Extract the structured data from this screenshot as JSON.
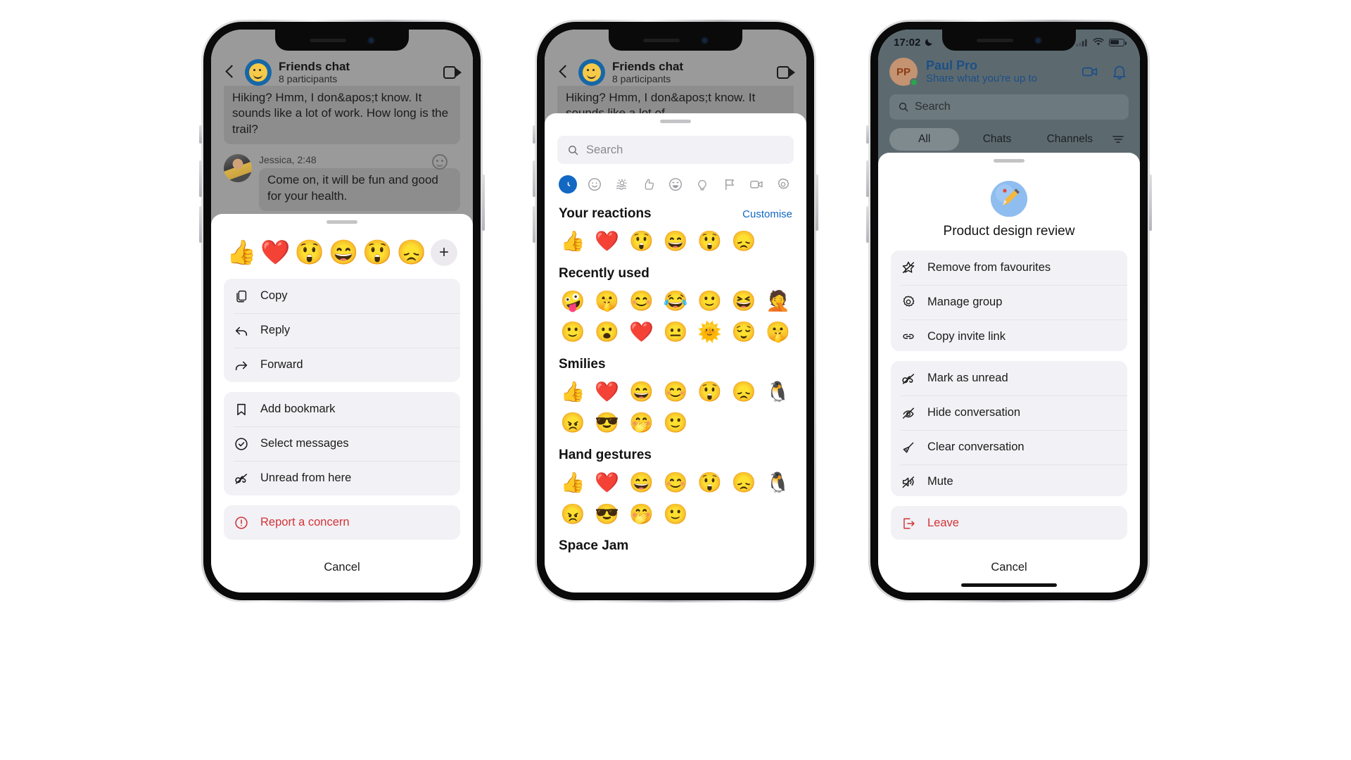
{
  "phone1": {
    "chat": {
      "title": "Friends chat",
      "subtitle": "8 participants",
      "back_icon": "chevron-left-icon",
      "video_icon": "video-camera-icon",
      "messages": [
        {
          "text": "Hiking? Hmm, I don&apos;t know. It sounds like a lot of work. How long is the trail?"
        },
        {
          "sender": "Jessica, 2:48",
          "text": "Come on, it will be fun and good for your health."
        }
      ]
    },
    "sheet": {
      "reactions": [
        "👍",
        "❤️",
        "😲",
        "😄",
        "😲",
        "😞"
      ],
      "add_reaction_label": "+",
      "groups": [
        {
          "items": [
            {
              "label": "Copy",
              "icon": "copy-icon"
            },
            {
              "label": "Reply",
              "icon": "reply-arrow-icon"
            },
            {
              "label": "Forward",
              "icon": "forward-arrow-icon"
            }
          ]
        },
        {
          "items": [
            {
              "label": "Add bookmark",
              "icon": "bookmark-icon"
            },
            {
              "label": "Select messages",
              "icon": "check-circle-icon"
            },
            {
              "label": "Unread from here",
              "icon": "unread-glasses-icon"
            }
          ]
        },
        {
          "items": [
            {
              "label": "Report a concern",
              "icon": "alert-circle-icon",
              "danger": true
            }
          ]
        }
      ],
      "cancel_label": "Cancel"
    }
  },
  "phone2": {
    "chat": {
      "title": "Friends chat",
      "subtitle": "8 participants",
      "back_icon": "chevron-left-icon",
      "video_icon": "video-camera-icon",
      "messages": [
        {
          "text": "Hiking? Hmm, I don&apos;t know. It sounds like a lot of"
        }
      ]
    },
    "picker": {
      "search_placeholder": "Search",
      "search_icon": "search-icon",
      "categories": [
        {
          "icon": "recent-clock-icon",
          "active": true
        },
        {
          "icon": "smiley-face-icon",
          "active": false
        },
        {
          "icon": "nature-sunset-icon",
          "active": false
        },
        {
          "icon": "thumbs-up-icon",
          "active": false
        },
        {
          "icon": "grinning-face-icon",
          "active": false
        },
        {
          "icon": "lightbulb-icon",
          "active": false
        },
        {
          "icon": "flag-icon",
          "active": false
        },
        {
          "icon": "video-camera-icon",
          "active": false
        },
        {
          "icon": "gear-icon",
          "active": false
        }
      ],
      "sections": [
        {
          "title": "Your reactions",
          "link": "Customise",
          "emojis": [
            "👍",
            "❤️",
            "😲",
            "😄",
            "😲",
            "😞"
          ]
        },
        {
          "title": "Recently used",
          "link": "",
          "emojis": [
            "🤪",
            "🤫",
            "😊",
            "😂",
            "🙂",
            "😆",
            "🤦",
            "🙂",
            "😮",
            "❤️",
            "😐",
            "🌞",
            "😌",
            "🤫"
          ]
        },
        {
          "title": "Smilies",
          "link": "",
          "emojis": [
            "👍",
            "❤️",
            "😄",
            "😊",
            "😲",
            "😞",
            "🐧",
            "😠",
            "😎",
            "🤭",
            "🙂"
          ]
        },
        {
          "title": "Hand gestures",
          "link": "",
          "emojis": [
            "👍",
            "❤️",
            "😄",
            "😊",
            "😲",
            "😞",
            "🐧",
            "😠",
            "😎",
            "🤭",
            "🙂"
          ]
        },
        {
          "title": "Space Jam",
          "link": "",
          "emojis": []
        }
      ]
    }
  },
  "phone3": {
    "status": {
      "time": "17:02",
      "moon_icon": "crescent-moon-icon",
      "signal_icon": "cellular-signal-icon",
      "wifi_icon": "wifi-icon",
      "battery_icon": "battery-icon"
    },
    "header": {
      "avatar_initials": "PP",
      "name": "Paul Pro",
      "status_text": "Share what you're up to",
      "meet_icon": "video-camera-icon",
      "bell_icon": "bell-icon"
    },
    "search": {
      "placeholder": "Search",
      "icon": "search-icon"
    },
    "tabs": [
      {
        "label": "All",
        "active": true
      },
      {
        "label": "Chats",
        "active": false
      },
      {
        "label": "Channels",
        "active": false
      }
    ],
    "filter_icon": "filter-icon",
    "sheet": {
      "icon": "pencil-circle-icon",
      "title": "Product design review",
      "groups": [
        {
          "items": [
            {
              "label": "Remove from favourites",
              "icon": "star-off-icon"
            },
            {
              "label": "Manage group",
              "icon": "gear-icon"
            },
            {
              "label": "Copy invite link",
              "icon": "link-icon"
            }
          ]
        },
        {
          "items": [
            {
              "label": "Mark as unread",
              "icon": "unread-glasses-icon"
            },
            {
              "label": "Hide conversation",
              "icon": "eye-off-icon"
            },
            {
              "label": "Clear conversation",
              "icon": "broom-icon"
            },
            {
              "label": "Mute",
              "icon": "speaker-mute-icon"
            }
          ]
        },
        {
          "items": [
            {
              "label": "Leave",
              "icon": "leave-arrow-icon",
              "danger": true
            }
          ]
        }
      ],
      "cancel_label": "Cancel"
    }
  },
  "colors": {
    "accent_blue": "#1268c3",
    "danger_red": "#d13438",
    "sheet_bg": "#ffffff",
    "menu_bg": "#f2f1f5",
    "chat_bg": "#9a9a9a",
    "phone3_bg": "#5c6a70"
  }
}
